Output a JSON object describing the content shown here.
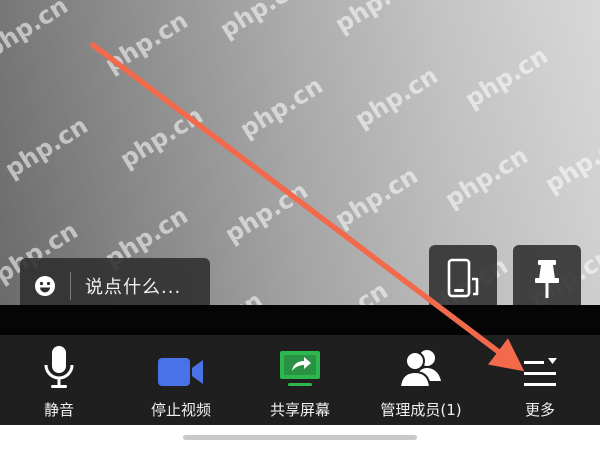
{
  "colors": {
    "toolbar_bg": "#1f1f20",
    "video_accent": "#4a72e8",
    "share_accent": "#2db84f",
    "annotation_arrow": "#f26a4b"
  },
  "watermark": "php.cn",
  "chat": {
    "placeholder": "说点什么...",
    "emoji_icon": "emoji-icon"
  },
  "floating_buttons": {
    "rotate_icon": "phone-rotate-icon",
    "pin_icon": "pin-icon"
  },
  "toolbar": {
    "mute_label": "静音",
    "video_label": "停止视频",
    "share_label": "共享屏幕",
    "members_label": "管理成员(1)",
    "more_label": "更多"
  }
}
